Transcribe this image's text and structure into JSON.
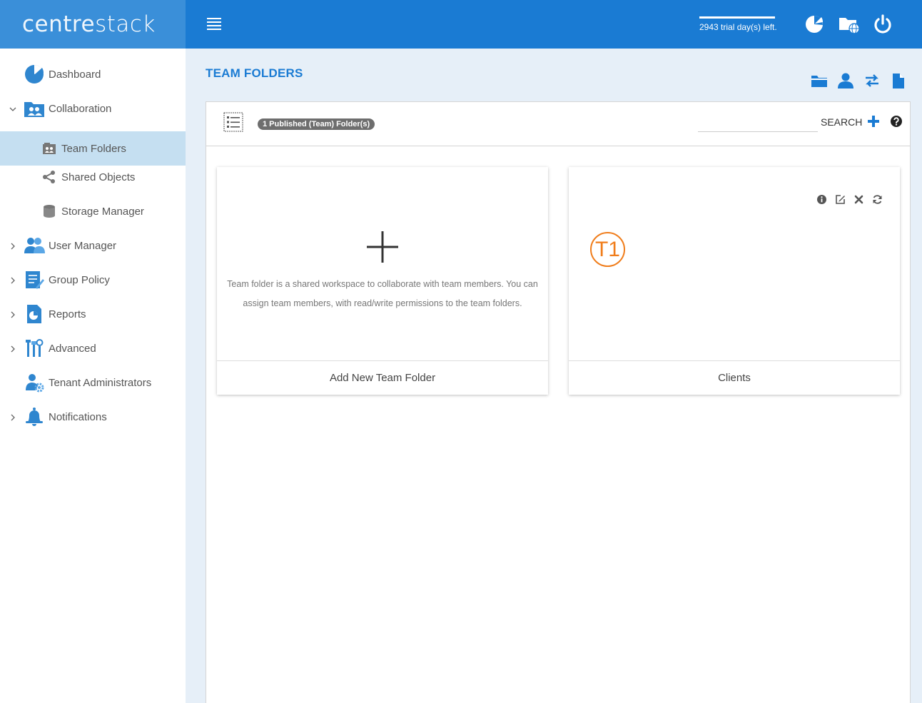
{
  "app": {
    "logo_text_1": "centre",
    "logo_text_2": "stack"
  },
  "topbar": {
    "trial_text": "2943 trial day(s) left."
  },
  "sidebar": {
    "items": [
      {
        "label": "Dashboard"
      },
      {
        "label": "Collaboration"
      },
      {
        "label": "Team Folders"
      },
      {
        "label": "Shared Objects"
      },
      {
        "label": "Storage Manager"
      },
      {
        "label": "User Manager"
      },
      {
        "label": "Group Policy"
      },
      {
        "label": "Reports"
      },
      {
        "label": "Advanced"
      },
      {
        "label": "Tenant Administrators"
      },
      {
        "label": "Notifications"
      }
    ]
  },
  "main": {
    "title": "TEAM FOLDERS",
    "count_badge": "1 Published (Team) Folder(s)",
    "search_label": "SEARCH",
    "add_card": {
      "description": "Team folder is a shared workspace to collaborate with team members. You can assign team members, with read/write permissions to the team folders.",
      "footer": "Add New Team Folder"
    },
    "folder_card": {
      "avatar": "T1",
      "footer": "Clients"
    }
  },
  "colors": {
    "brand_dark": "#1a7bd3",
    "brand_light": "#3a8fd9",
    "active_bg": "#c5dff1",
    "avatar_orange": "#f07d1b"
  }
}
